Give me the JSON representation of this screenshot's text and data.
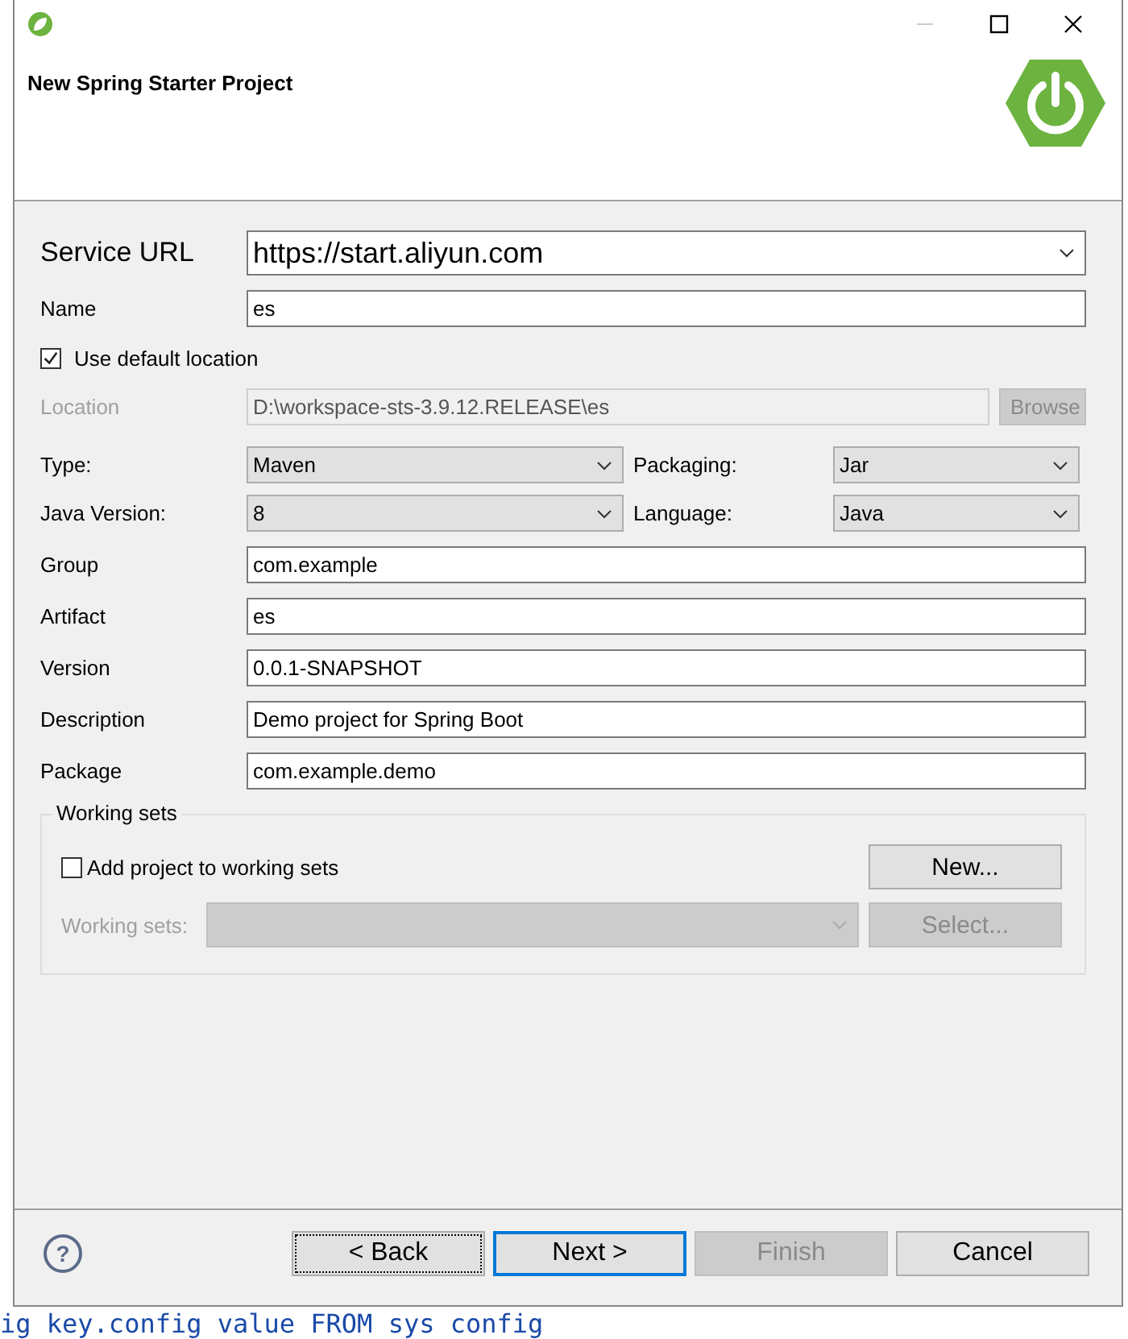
{
  "window": {
    "title": "New Spring Starter Project"
  },
  "service_url": {
    "label": "Service URL",
    "value": "https://start.aliyun.com"
  },
  "name": {
    "label": "Name",
    "value": "es"
  },
  "use_default_location": {
    "label": "Use default location",
    "checked": true
  },
  "location": {
    "label": "Location",
    "value": "D:\\workspace-sts-3.9.12.RELEASE\\es",
    "disabled": true,
    "browse": "Browse"
  },
  "combos": [
    {
      "label": "Type:",
      "value": "Maven"
    },
    {
      "label": "Packaging:",
      "value": "Jar"
    },
    {
      "label": "Java Version:",
      "value": "8"
    },
    {
      "label": "Language:",
      "value": "Java"
    }
  ],
  "fields": [
    {
      "label": "Group",
      "value": "com.example"
    },
    {
      "label": "Artifact",
      "value": "es"
    },
    {
      "label": "Version",
      "value": "0.0.1-SNAPSHOT"
    },
    {
      "label": "Description",
      "value": "Demo project for Spring Boot"
    },
    {
      "label": "Package",
      "value": "com.example.demo"
    }
  ],
  "working_sets": {
    "title": "Working sets",
    "add": {
      "label": "Add project to working sets",
      "checked": false
    },
    "new_button": "New...",
    "sets_label": "Working sets:",
    "select_button": "Select...",
    "disabled": true
  },
  "help": "?",
  "buttons": [
    {
      "label": "< Back",
      "disabled": false,
      "focused": true,
      "default": false
    },
    {
      "label": "Next >",
      "disabled": false,
      "focused": false,
      "default": true
    },
    {
      "label": "Finish",
      "disabled": true,
      "focused": false,
      "default": false
    },
    {
      "label": "Cancel",
      "disabled": false,
      "focused": false,
      "default": false
    }
  ],
  "background_code": "ig key.config value FROM sys config"
}
